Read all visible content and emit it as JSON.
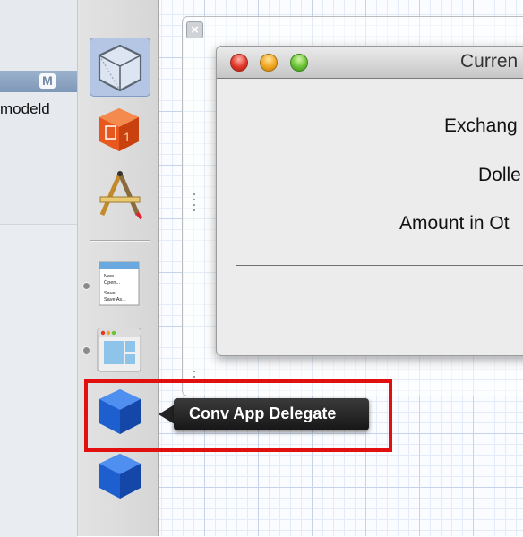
{
  "navigator": {
    "badge": "M",
    "file_name": "modeld"
  },
  "dock": {
    "items": [
      {
        "icon": "cube-wireframe-icon",
        "selected": true
      },
      {
        "icon": "object-library-icon"
      },
      {
        "icon": "application-icon"
      },
      {
        "icon": "main-menu-icon",
        "menu_lines": [
          "New...",
          "Open...",
          "",
          "Save",
          "Save As..."
        ]
      },
      {
        "icon": "window-icon"
      },
      {
        "icon": "blue-cube-icon",
        "tooltip": "Conv App Delegate"
      },
      {
        "icon": "blue-cube-icon"
      }
    ]
  },
  "window": {
    "title": "Curren",
    "labels": [
      "Exchang",
      "Dolle",
      "Amount in Ot"
    ]
  },
  "tooltip": {
    "text": "Conv App Delegate"
  },
  "colors": {
    "highlight": "#e20f0f",
    "selection": "#b4c6e3",
    "file_row": "#8ea6c3"
  }
}
